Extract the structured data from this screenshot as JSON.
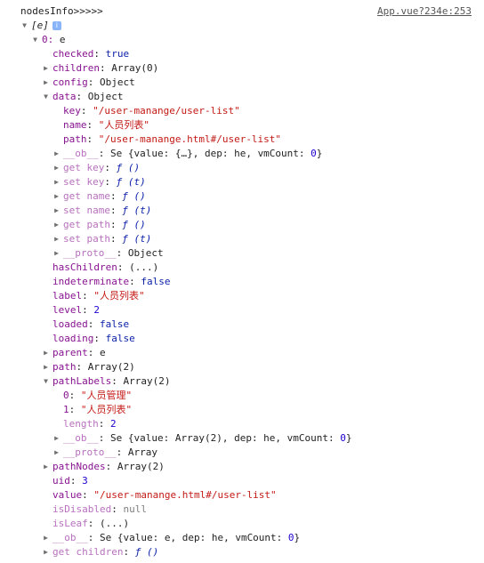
{
  "console": {
    "log_label": "nodesInfo>>>>>",
    "source_link": "App.vue?234e:253",
    "root_preview": "[e]",
    "item0_label": "0:",
    "item0_value": "e"
  },
  "props": {
    "checked": {
      "k": "checked",
      "v": "true"
    },
    "children": {
      "k": "children",
      "v": "Array(0)"
    },
    "config": {
      "k": "config",
      "v": "Object"
    },
    "data": {
      "k": "data",
      "v": "Object"
    },
    "data_key": {
      "k": "key",
      "v": "\"/user-manange/user-list\""
    },
    "data_name": {
      "k": "name",
      "v": "\"人员列表\""
    },
    "data_path": {
      "k": "path",
      "v": "\"/user-manange.html#/user-list\""
    },
    "data_ob": {
      "k": "__ob__",
      "v": "Se {value: {…}, dep: he, vmCount: ",
      "n": "0",
      "e": "}"
    },
    "get_key": {
      "k": "get key",
      "v": "ƒ ()"
    },
    "set_key": {
      "k": "set key",
      "v": "ƒ (t)"
    },
    "get_name": {
      "k": "get name",
      "v": "ƒ ()"
    },
    "set_name": {
      "k": "set name",
      "v": "ƒ (t)"
    },
    "get_path": {
      "k": "get path",
      "v": "ƒ ()"
    },
    "set_path": {
      "k": "set path",
      "v": "ƒ (t)"
    },
    "data_proto": {
      "k": "__proto__",
      "v": "Object"
    },
    "hasChildren": {
      "k": "hasChildren",
      "v": "(...)"
    },
    "indeterminate": {
      "k": "indeterminate",
      "v": "false"
    },
    "label": {
      "k": "label",
      "v": "\"人员列表\""
    },
    "level": {
      "k": "level",
      "v": "2"
    },
    "loaded": {
      "k": "loaded",
      "v": "false"
    },
    "loading": {
      "k": "loading",
      "v": "false"
    },
    "parent": {
      "k": "parent",
      "v": "e"
    },
    "path": {
      "k": "path",
      "v": "Array(2)"
    },
    "pathLabels": {
      "k": "pathLabels",
      "v": "Array(2)"
    },
    "pl_0": {
      "k": "0",
      "v": "\"人员管理\""
    },
    "pl_1": {
      "k": "1",
      "v": "\"人员列表\""
    },
    "pl_length": {
      "k": "length",
      "v": "2"
    },
    "pl_ob": {
      "k": "__ob__",
      "v": "Se {value: Array(2), dep: he, vmCount: ",
      "n": "0",
      "e": "}"
    },
    "pl_proto": {
      "k": "__proto__",
      "v": "Array"
    },
    "pathNodes": {
      "k": "pathNodes",
      "v": "Array(2)"
    },
    "uid": {
      "k": "uid",
      "v": "3"
    },
    "value": {
      "k": "value",
      "v": "\"/user-manange.html#/user-list\""
    },
    "isDisabled": {
      "k": "isDisabled",
      "v": "null"
    },
    "isLeaf": {
      "k": "isLeaf",
      "v": "(...)"
    },
    "ob": {
      "k": "__ob__",
      "v": "Se {value: e, dep: he, vmCount: ",
      "n": "0",
      "e": "}"
    },
    "get_children": {
      "k": "get children",
      "v": "ƒ ()"
    }
  },
  "icons": {
    "expanded": "▼",
    "collapsed": "▶",
    "info": "i"
  }
}
